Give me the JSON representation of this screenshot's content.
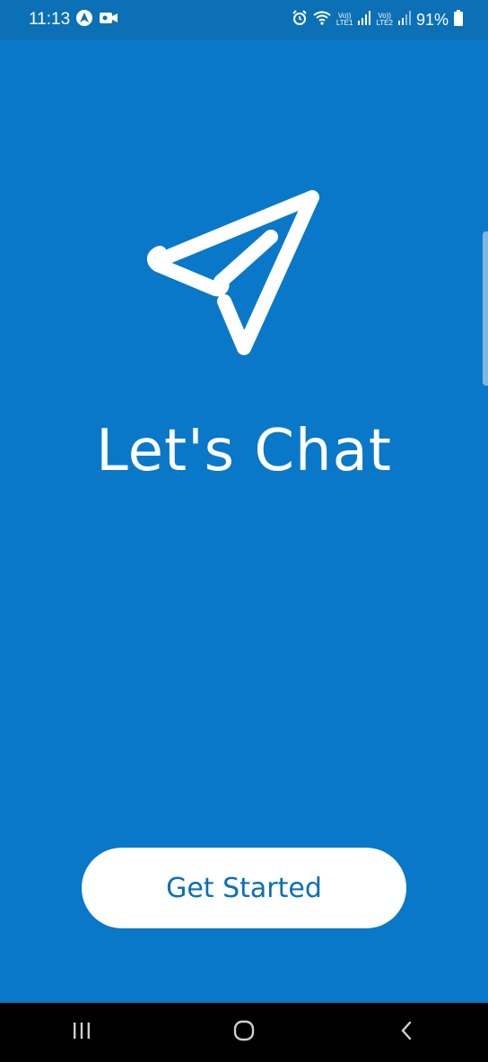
{
  "status_bar": {
    "time": "11:13",
    "left_icons": [
      "navigation-app-icon",
      "video-camera-icon"
    ],
    "right_icons": [
      "alarm-icon",
      "wifi-icon",
      "signal-sim1-icon",
      "signal-sim2-icon",
      "battery-icon"
    ],
    "sim1_label_top": "Vo))",
    "sim1_label_bottom": "LTE1",
    "sim2_label_top": "Vo))",
    "sim2_label_bottom": "LTE2",
    "battery_percent": "91%"
  },
  "hero": {
    "logo_icon": "paper-plane-icon",
    "title": "Let's Chat"
  },
  "cta": {
    "label": "Get Started"
  },
  "colors": {
    "background": "#0a78c8",
    "status_bar": "#0b70b6",
    "button_bg": "#ffffff",
    "button_text": "#0a6fb6",
    "nav_bar": "#000000"
  },
  "nav_bar": {
    "buttons": [
      "recent-apps-icon",
      "home-icon",
      "back-icon"
    ]
  }
}
